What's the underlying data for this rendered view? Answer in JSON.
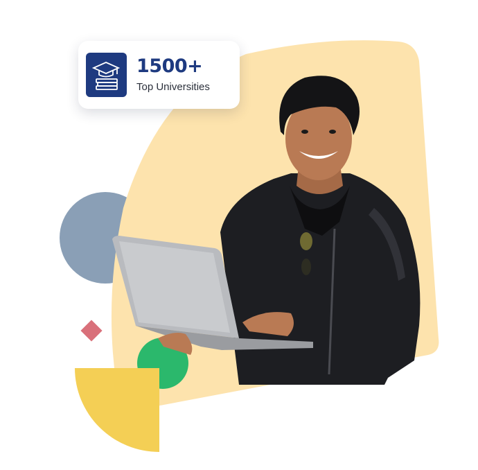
{
  "stat_card": {
    "number": "1500+",
    "label": "Top Universities",
    "icon": "graduation-cap-books-icon"
  },
  "colors": {
    "blob": "#fde3ad",
    "card_icon_bg": "#1e3a80",
    "stat_number": "#1e3a80",
    "slate_circle": "#8a9fb6",
    "diamond": "#d9707a",
    "green_circle": "#2bb86c",
    "yellow_quarter": "#f4cf55"
  },
  "image": {
    "subject": "smiling student holding an open laptop, wearing a black leather jacket"
  }
}
